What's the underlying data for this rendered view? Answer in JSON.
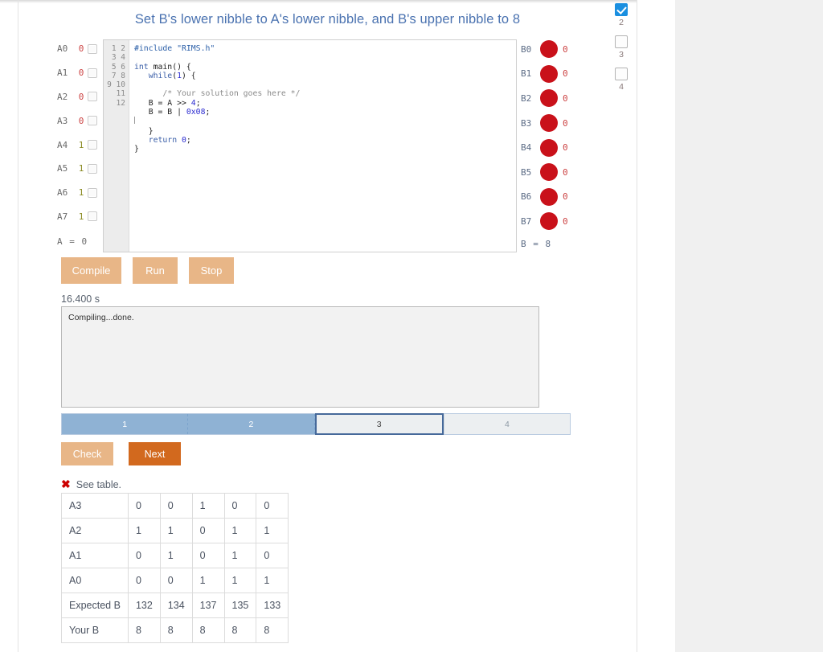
{
  "page": {
    "title": "Set B's lower nibble to A's lower nibble, and B's upper nibble to 8"
  },
  "registers": {
    "a": {
      "summary": "A  =  0",
      "bits": [
        {
          "label": "A0",
          "value": "0"
        },
        {
          "label": "A1",
          "value": "0"
        },
        {
          "label": "A2",
          "value": "0"
        },
        {
          "label": "A3",
          "value": "0"
        },
        {
          "label": "A4",
          "value": "1"
        },
        {
          "label": "A5",
          "value": "1"
        },
        {
          "label": "A6",
          "value": "1"
        },
        {
          "label": "A7",
          "value": "1"
        }
      ]
    },
    "b": {
      "summary": "B  =  8",
      "bits": [
        {
          "label": "B0",
          "value": "0"
        },
        {
          "label": "B1",
          "value": "0"
        },
        {
          "label": "B2",
          "value": "0"
        },
        {
          "label": "B3",
          "value": "0"
        },
        {
          "label": "B4",
          "value": "0"
        },
        {
          "label": "B5",
          "value": "0"
        },
        {
          "label": "B6",
          "value": "0"
        },
        {
          "label": "B7",
          "value": "0"
        }
      ]
    }
  },
  "editor": {
    "line_numbers": "1\n2\n3\n4\n5\n6\n7\n8\n9\n10\n11\n12",
    "lines": [
      "#include \"RIMS.h\"",
      "",
      "int main() {",
      "   while(1) {",
      "",
      "      /* Your solution goes here */",
      "   B = A >> 4;",
      "   B = B | 0x08;",
      "",
      "   }",
      "   return 0;",
      "}"
    ]
  },
  "toolbar": {
    "compile_label": "Compile",
    "run_label": "Run",
    "stop_label": "Stop"
  },
  "timer": {
    "value": "16.400 s"
  },
  "console": {
    "output": "Compiling...done."
  },
  "steps": [
    {
      "label": "1",
      "state": "done"
    },
    {
      "label": "2",
      "state": "done"
    },
    {
      "label": "3",
      "state": "current"
    },
    {
      "label": "4",
      "state": "todo"
    }
  ],
  "actions": {
    "check_label": "Check",
    "next_label": "Next"
  },
  "verdict": {
    "icon": "x-mark-icon",
    "text": "See table."
  },
  "results_table": {
    "rows": [
      {
        "header": "A3",
        "cells": [
          "0",
          "0",
          "1",
          "0",
          "0"
        ]
      },
      {
        "header": "A2",
        "cells": [
          "1",
          "1",
          "0",
          "1",
          "1"
        ]
      },
      {
        "header": "A1",
        "cells": [
          "0",
          "1",
          "0",
          "1",
          "0"
        ]
      },
      {
        "header": "A0",
        "cells": [
          "0",
          "0",
          "1",
          "1",
          "1"
        ]
      },
      {
        "header": "Expected B",
        "cells": [
          "132",
          "134",
          "137",
          "135",
          "133"
        ]
      },
      {
        "header": "Your B",
        "cells": [
          "8",
          "8",
          "8",
          "8",
          "8"
        ]
      }
    ]
  },
  "sidebar": {
    "items": [
      {
        "checked": true,
        "number": "2"
      },
      {
        "checked": false,
        "number": "3"
      },
      {
        "checked": false,
        "number": "4"
      }
    ]
  },
  "colors": {
    "accent_blue": "#4a72b0",
    "led_red": "#c9111a",
    "button_tan": "#e8b687",
    "button_orange": "#d2691e",
    "step_done": "#8fb2d4",
    "step_border": "#46699a",
    "check_blue": "#1a8fe0",
    "bit_zero": "#cc4444",
    "bit_one": "#8a8a22"
  }
}
